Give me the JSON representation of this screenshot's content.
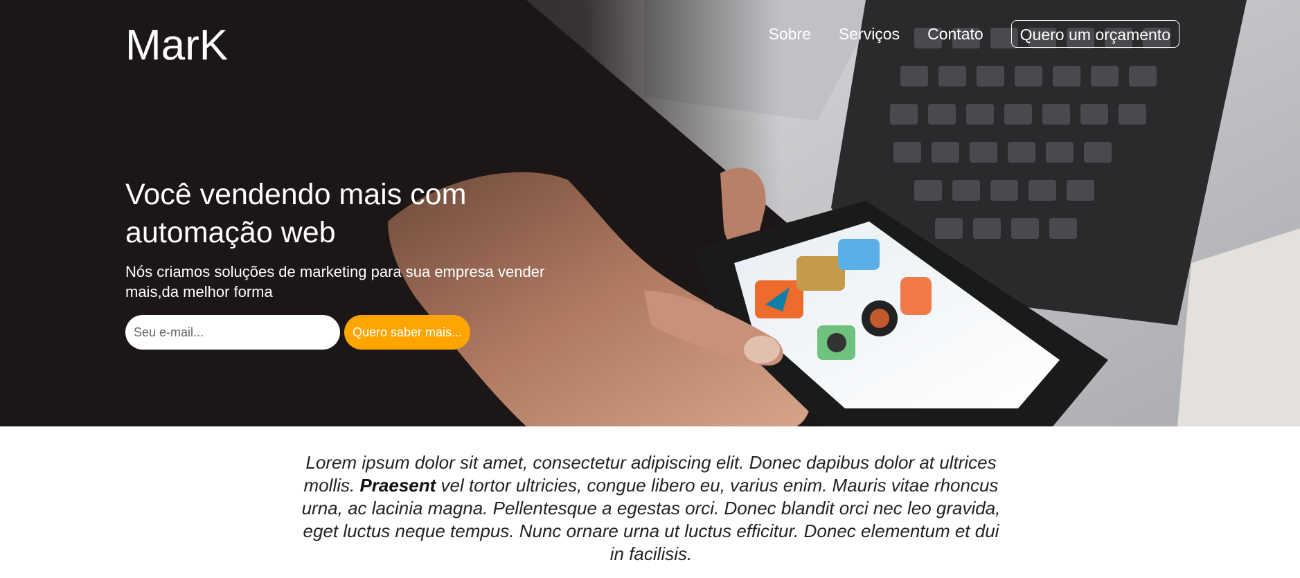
{
  "brand": {
    "logo": "MarK"
  },
  "nav": {
    "links": [
      "Sobre",
      "Serviços",
      "Contato"
    ],
    "cta_label": "Quero um orçamento"
  },
  "hero": {
    "headline": "Você vendendo mais com automação web",
    "subtitle": "Nós criamos soluções de marketing para sua empresa vender mais,da melhor forma",
    "email_placeholder": "Seu e-mail...",
    "email_value": "",
    "submit_label": "Quero saber mais..."
  },
  "intro": {
    "text_before": "Lorem ipsum dolor sit amet, consectetur adipiscing elit. Donec dapibus dolor at ultrices mollis. ",
    "emphasis": "Praesent",
    "text_after": " vel tortor ultricies, congue libero eu, varius enim. Mauris vitae rhoncus urna, ac lacinia magna. Pellentesque a egestas orci. Donec blandit orci nec leo gravida, eget luctus neque tempus. Nunc ornare urna ut luctus efficitur. Donec elementum et dui in facilisis."
  },
  "colors": {
    "hero_background": "#1c1616",
    "accent": "#ffa500",
    "text_light": "#ffffff",
    "text_dark": "#222222"
  }
}
